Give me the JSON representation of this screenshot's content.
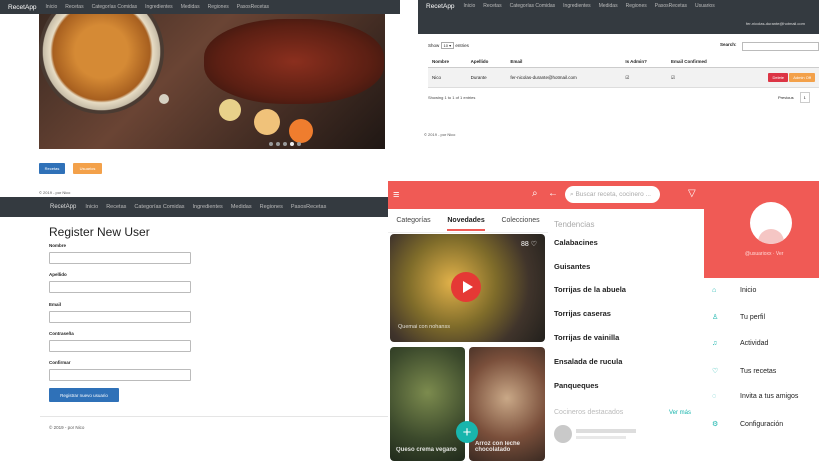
{
  "q1": {
    "nav": {
      "brand": "RecetApp",
      "items": [
        "Inicio",
        "Recetas",
        "Categorías Comidas",
        "Ingredientes",
        "Medidas",
        "Regiones",
        "PasosRecetas"
      ]
    },
    "buttons": {
      "recetas": "Recetas",
      "usuarios": "Usuarios"
    },
    "footer": "© 2019 - por Nico"
  },
  "q2": {
    "nav": {
      "brand": "RecetApp",
      "items": [
        "Inicio",
        "Recetas",
        "Categorías Comidas",
        "Ingredientes",
        "Medidas",
        "Regiones",
        "PasosRecetas",
        "Usuarios"
      ],
      "user_email": "fer-nicolas-durante@hotmail.com"
    },
    "show_label": "Show",
    "show_value": "10",
    "entries_label": "entries",
    "search_label": "Search:",
    "table": {
      "headers": [
        "Nombre",
        "Apellido",
        "Email",
        "Is Admin?",
        "Email Confirmed"
      ],
      "rows": [
        {
          "nombre": "Nico",
          "apellido": "Durante",
          "email": "fer-nicolas-durante@hotmail.com"
        }
      ]
    },
    "delete_label": "Delete",
    "admin_label": "Admin Off",
    "info": "Showing 1 to 1 of 1 entries",
    "previous": "Previous",
    "page": "1",
    "footer": "© 2019 - por Nico"
  },
  "q3": {
    "nav": {
      "brand": "RecetApp",
      "items": [
        "Inicio",
        "Recetas",
        "Categorías Comidas",
        "Ingredientes",
        "Medidas",
        "Regiones",
        "PasosRecetas"
      ]
    },
    "title": "Register New User",
    "fields": {
      "nombre": "Nombre",
      "apellido": "Apellido",
      "email": "Email",
      "contrasena": "Contraseña",
      "confirmar": "Confirmar"
    },
    "submit": "Registrar nuevo usuario",
    "footer": "© 2019 - por Nico"
  },
  "q4": {
    "search_placeholder": "Buscar receta, cocinero ...",
    "tabs": [
      "Categorías",
      "Novedades",
      "Colecciones"
    ],
    "likes": "88",
    "card_title": "Quemai con nohanss",
    "card2_title": "Queso crema vegano",
    "card3_title": "Arroz con leche chocolatado",
    "tendencias_label": "Tendencias",
    "trends": [
      "Calabacines",
      "Guisantes",
      "Torrijas de la abuela",
      "Torrijas caseras",
      "Torrijas de vainilla",
      "Ensalada de rucula",
      "Panqueques"
    ],
    "cocineros_label": "Cocineros destacados",
    "ver_mas": "Ver más",
    "drawer_name": "@usuarioxx · Ver",
    "menu": [
      {
        "label": "Inicio",
        "icon": "home-icon"
      },
      {
        "label": "Tu perfil",
        "icon": "person-icon"
      },
      {
        "label": "Actividad",
        "icon": "bell-icon"
      },
      {
        "label": "Tus recetas",
        "icon": "heart-icon"
      },
      {
        "label": "Invita a tus amigos",
        "icon": "chat-icon"
      },
      {
        "label": "Configuración",
        "icon": "gear-icon"
      }
    ],
    "colors": {
      "brand": "#f05a55",
      "accent": "#18b5ad"
    }
  }
}
